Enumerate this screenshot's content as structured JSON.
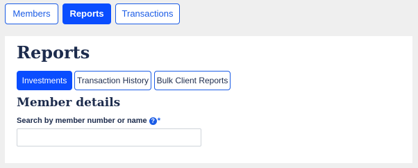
{
  "top_nav": {
    "items": [
      {
        "label": "Members",
        "active": false
      },
      {
        "label": "Reports",
        "active": true
      },
      {
        "label": "Transactions",
        "active": false
      }
    ]
  },
  "page": {
    "title": "Reports"
  },
  "sub_tabs": {
    "items": [
      {
        "label": "Investments",
        "active": true
      },
      {
        "label": "Transaction History",
        "active": false
      },
      {
        "label": "Bulk Client Reports",
        "active": false
      }
    ]
  },
  "member_details": {
    "title": "Member details",
    "search": {
      "label": "Search by member number or name",
      "help_icon": "question-circle-icon",
      "help_glyph": "?",
      "required_mark": "*",
      "value": "",
      "placeholder": ""
    }
  },
  "colors": {
    "accent": "#0a4dff",
    "link_blue": "#1b5ce6",
    "heading": "#1c2b4c",
    "page_background": "#efefef",
    "panel_background": "#ffffff"
  }
}
